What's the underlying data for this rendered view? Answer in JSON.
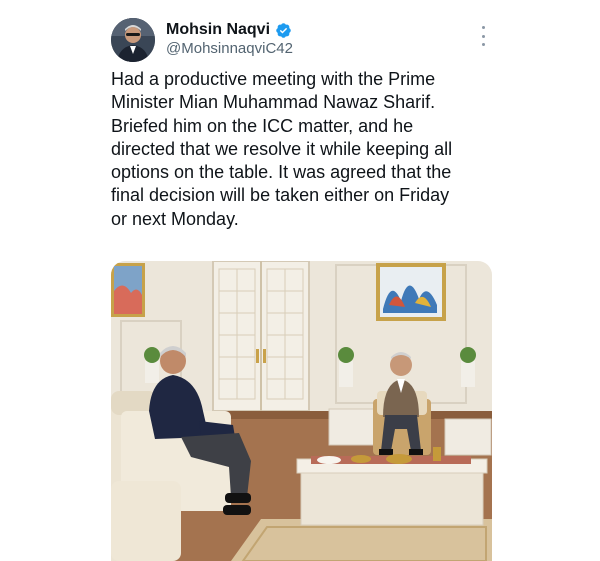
{
  "tweet": {
    "author": {
      "display_name": "Mohsin Naqvi",
      "handle": "@MohsinnaqviC42",
      "verified": true,
      "verified_color": "#1d9bf0"
    },
    "text_lines": [
      "Had a productive meeting with the Prime",
      "Minister Mian Muhammad Nawaz Sharif.",
      "Briefed him on the ICC matter, and he",
      "directed that we resolve it while keeping all",
      "options on the table. It was agreed that the",
      "final decision will be taken either on Friday",
      "or next Monday."
    ],
    "more_icon": "more-vertical-icon",
    "media": {
      "kind": "photo"
    }
  },
  "colors": {
    "text_primary": "#0f1419",
    "text_secondary": "#536471",
    "accent": "#1d9bf0"
  }
}
